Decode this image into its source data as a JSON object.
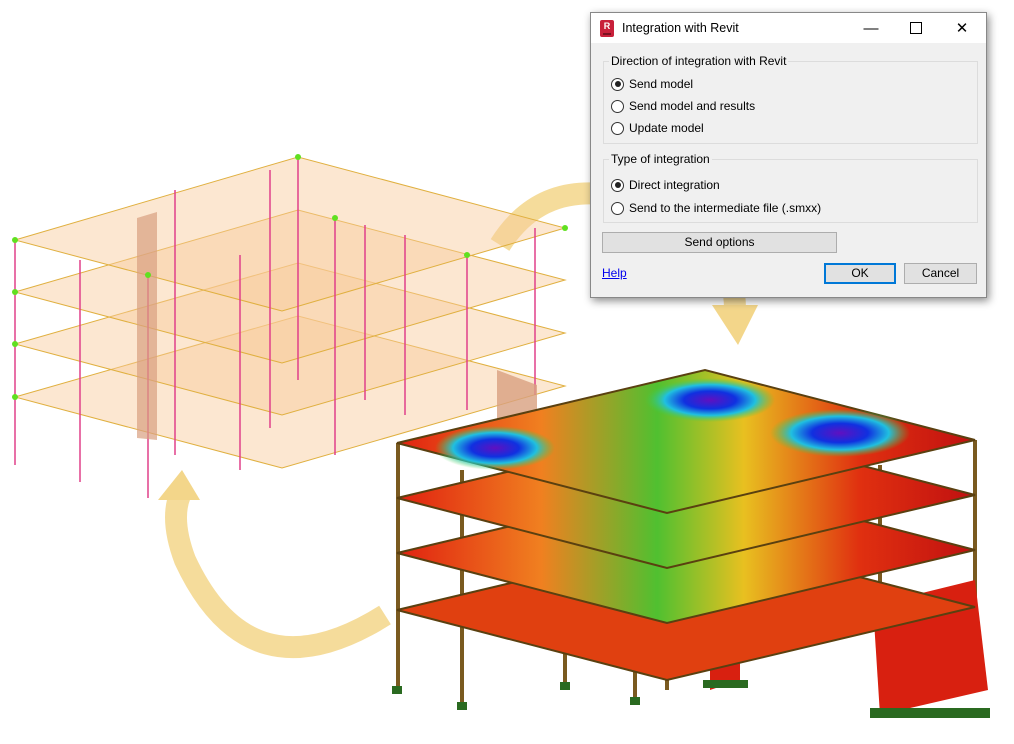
{
  "dialog": {
    "title": "Integration with Revit",
    "app_icon_letter": "R",
    "minimize_icon": "minimize-icon",
    "maximize_icon": "maximize-icon",
    "close_icon": "close-icon",
    "direction_group": {
      "label": "Direction of integration with Revit",
      "options": [
        {
          "label": "Send model",
          "selected": true
        },
        {
          "label": "Send model and results",
          "selected": false
        },
        {
          "label": "Update model",
          "selected": false
        }
      ]
    },
    "type_group": {
      "label": "Type of integration",
      "options": [
        {
          "label": "Direct integration",
          "selected": true
        },
        {
          "label": "Send to the intermediate file (.smxx)",
          "selected": false
        }
      ]
    },
    "send_options_label": "Send options",
    "help_label": "Help",
    "ok_label": "OK",
    "cancel_label": "Cancel"
  },
  "colors": {
    "accent": "#0078d7",
    "arrow": "#f3d68a",
    "slab": "#f9c99a",
    "column": "#e0408a",
    "frame": "#9a7a3a"
  }
}
